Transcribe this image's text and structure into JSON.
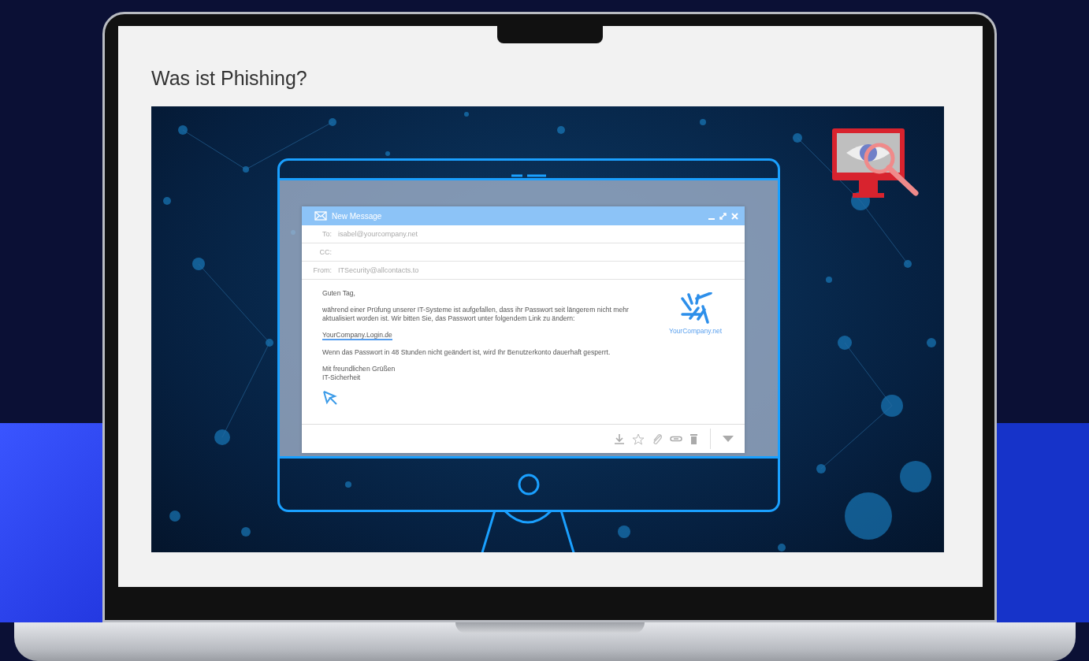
{
  "slide": {
    "title": "Was ist Phishing?"
  },
  "email": {
    "window_title": "New Message",
    "fields": [
      {
        "label": "To:",
        "value": "isabel@yourcompany.net"
      },
      {
        "label": "CC:"
      },
      {
        "label": "From:",
        "value": "ITSecurity@allcontacts.to"
      }
    ],
    "body": [
      {
        "kind": "text",
        "text": "Guten Tag,"
      },
      {
        "kind": "text",
        "text": "während einer Prüfung unserer IT-Systeme ist aufgefallen, dass ihr Passwort seit längerem nicht mehr aktualisiert worden ist. Wir bitten Sie, das Passwort unter folgendem Link zu ändern:"
      },
      {
        "kind": "link",
        "text": "YourCompany.Login.de"
      },
      {
        "kind": "text",
        "text": "Wenn das Passwort in 48 Stunden nicht geändert ist, wird Ihr Benutzerkonto dauerhaft gesperrt."
      },
      {
        "kind": "lines",
        "lines": [
          "Mit freundlichen Grüßen",
          "IT-Sicherheit"
        ]
      }
    ],
    "logo_text": "YourCompany.net"
  }
}
